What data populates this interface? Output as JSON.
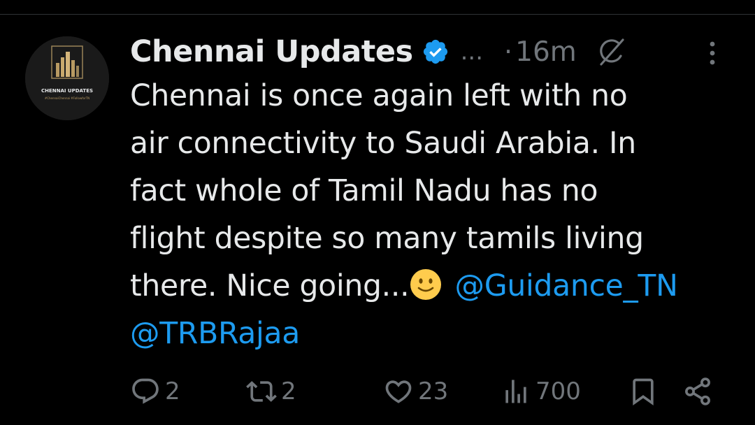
{
  "tweet": {
    "author": {
      "display_name": "Chennai Updates",
      "verified": true,
      "name_overflow": "...",
      "avatar": {
        "brand_text": "CHENNAI UPDATES",
        "sub_text": "#ChennaiChennai #FollowforTN"
      }
    },
    "separator": "·",
    "time": "16m",
    "icons": {
      "verified": "verified-badge-icon",
      "grok": "grok-icon",
      "more": "more-vertical-icon"
    },
    "text": {
      "line1": "Chennai is once again left with no",
      "line2": "air connectivity to Saudi Arabia. In",
      "line3": "fact whole of Tamil Nadu has no",
      "line4": "flight despite so many tamils living",
      "line5_prefix": "there. Nice going...",
      "emoji": "slightly-smiling-face",
      "mention1": "@Guidance_TN",
      "mention2": "@TRBRajaa"
    },
    "actions": {
      "replies": "2",
      "retweets": "2",
      "likes": "23",
      "views": "700"
    }
  },
  "colors": {
    "background": "#000000",
    "text": "#e7e9ea",
    "secondary": "#71767b",
    "accent": "#1d9bf0"
  }
}
